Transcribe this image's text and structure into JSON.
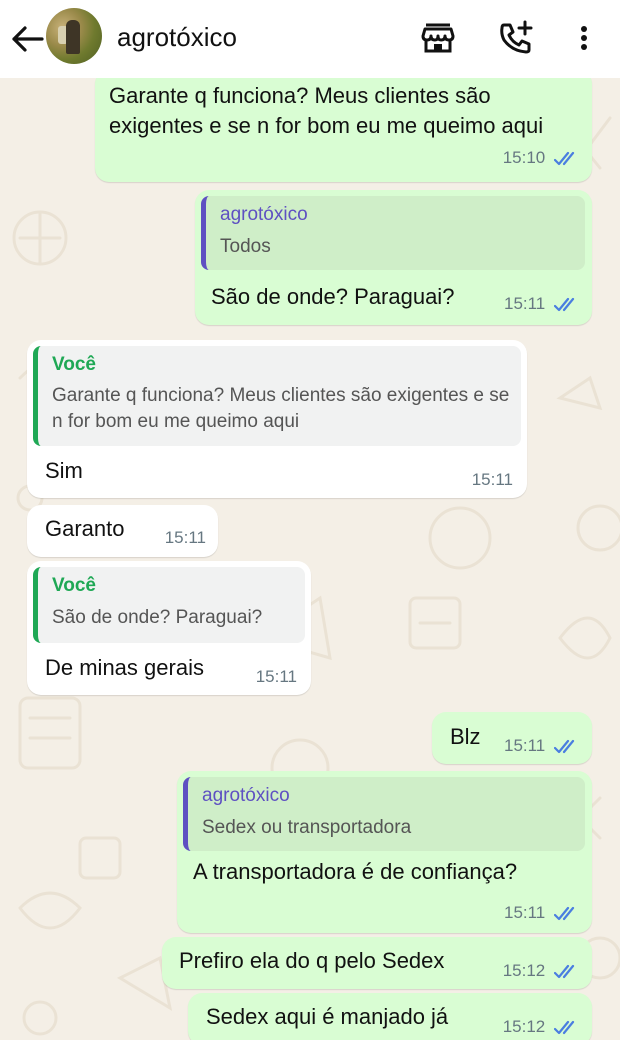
{
  "header": {
    "contact_name": "agrotóxico",
    "icons": [
      "back-arrow-icon",
      "avatar",
      "store-icon",
      "call-add-icon",
      "menu-icon"
    ]
  },
  "colors": {
    "outgoing_bubble": "#d9fdd3",
    "incoming_bubble": "#ffffff",
    "read_ticks": "#4a7ee0",
    "quote_author_purple": "#5e50c2",
    "quote_author_green": "#1fa855"
  },
  "messages": [
    {
      "dir": "out",
      "text": "Garante q funciona? Meus clientes são exigentes e se n for bom eu me queimo aqui",
      "time": "15:10",
      "read": true
    },
    {
      "dir": "out",
      "quote_author": "agrotóxico",
      "quote_text": "Todos",
      "text": "São de onde? Paraguai?",
      "time": "15:11",
      "read": true
    },
    {
      "dir": "in",
      "quote_author": "Você",
      "quote_text": "Garante q funciona? Meus clientes são exigentes e se n for bom eu me queimo aqui",
      "text": "Sim",
      "time": "15:11"
    },
    {
      "dir": "in",
      "text": "Garanto",
      "time": "15:11"
    },
    {
      "dir": "in",
      "quote_author": "Você",
      "quote_text": "São de onde? Paraguai?",
      "text": "De minas gerais",
      "time": "15:11"
    },
    {
      "dir": "out",
      "text": "Blz",
      "time": "15:11",
      "read": true
    },
    {
      "dir": "out",
      "quote_author": "agrotóxico",
      "quote_text": "Sedex ou transportadora",
      "text": "A transportadora é de confiança?",
      "time": "15:11",
      "read": true
    },
    {
      "dir": "out",
      "text": "Prefiro ela do q pelo Sedex",
      "time": "15:12",
      "read": true
    },
    {
      "dir": "out",
      "text": "Sedex aqui é manjado já",
      "time": "15:12",
      "read": true
    }
  ]
}
